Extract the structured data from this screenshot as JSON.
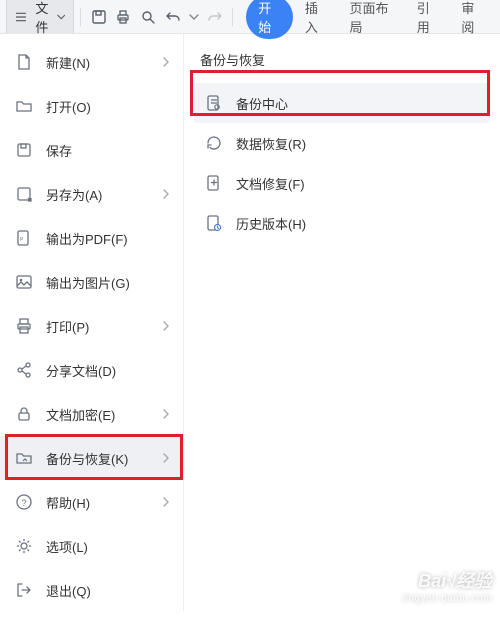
{
  "toolbar": {
    "file_label": "文件",
    "tabs": {
      "start": "开始",
      "insert": "插入",
      "layout": "页面布局",
      "ref": "引用",
      "review": "审阅"
    }
  },
  "menu": {
    "items": [
      {
        "label": "新建(N)",
        "has_arrow": true
      },
      {
        "label": "打开(O)",
        "has_arrow": false
      },
      {
        "label": "保存",
        "has_arrow": false
      },
      {
        "label": "另存为(A)",
        "has_arrow": true
      },
      {
        "label": "输出为PDF(F)",
        "has_arrow": false
      },
      {
        "label": "输出为图片(G)",
        "has_arrow": false
      },
      {
        "label": "打印(P)",
        "has_arrow": true
      },
      {
        "label": "分享文档(D)",
        "has_arrow": false
      },
      {
        "label": "文档加密(E)",
        "has_arrow": true
      },
      {
        "label": "备份与恢复(K)",
        "has_arrow": true
      },
      {
        "label": "帮助(H)",
        "has_arrow": true
      },
      {
        "label": "选项(L)",
        "has_arrow": false
      },
      {
        "label": "退出(Q)",
        "has_arrow": false
      }
    ]
  },
  "submenu": {
    "title": "备份与恢复",
    "items": [
      {
        "label": "备份中心"
      },
      {
        "label": "数据恢复(R)"
      },
      {
        "label": "文档修复(F)"
      },
      {
        "label": "历史版本(H)"
      }
    ]
  },
  "watermark": {
    "main": "Bai√经验",
    "sub": "jingyan.baidu.com"
  }
}
